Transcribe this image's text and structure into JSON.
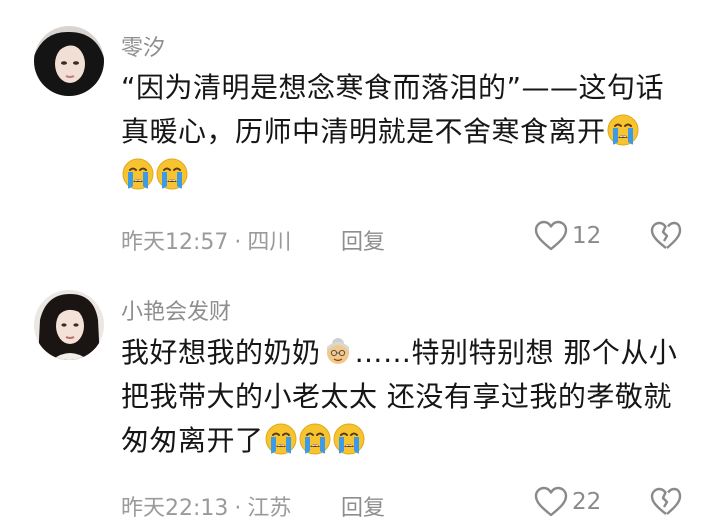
{
  "comments": [
    {
      "username": "零汐",
      "text_parts": [
        "“因为清明是想念寒食而落泪的”——这句话真暖心，历师中清明就是不舍寒食离开"
      ],
      "time": "昨天12:57",
      "location": "四川",
      "reply_label": "回复",
      "likes": "12",
      "emoji_trailing": [
        "crying-face",
        "crying-face",
        "crying-face"
      ]
    },
    {
      "username": "小艳会发财",
      "text_parts": [
        "我好想我的奶奶",
        "……特别特别想 那个从小把我带大的小老太太 还没有享过我的孝敬就匆匆离开了"
      ],
      "time": "昨天22:13",
      "location": "江苏",
      "reply_label": "回复",
      "likes": "22",
      "emoji_inline": "old-woman",
      "emoji_trailing": [
        "crying-face",
        "crying-face",
        "crying-face"
      ]
    }
  ],
  "colors": {
    "meta_gray": "#9a9a9a",
    "text": "#161616",
    "emoji_yellow": "#f7c430",
    "emoji_tear": "#3c9be8"
  }
}
